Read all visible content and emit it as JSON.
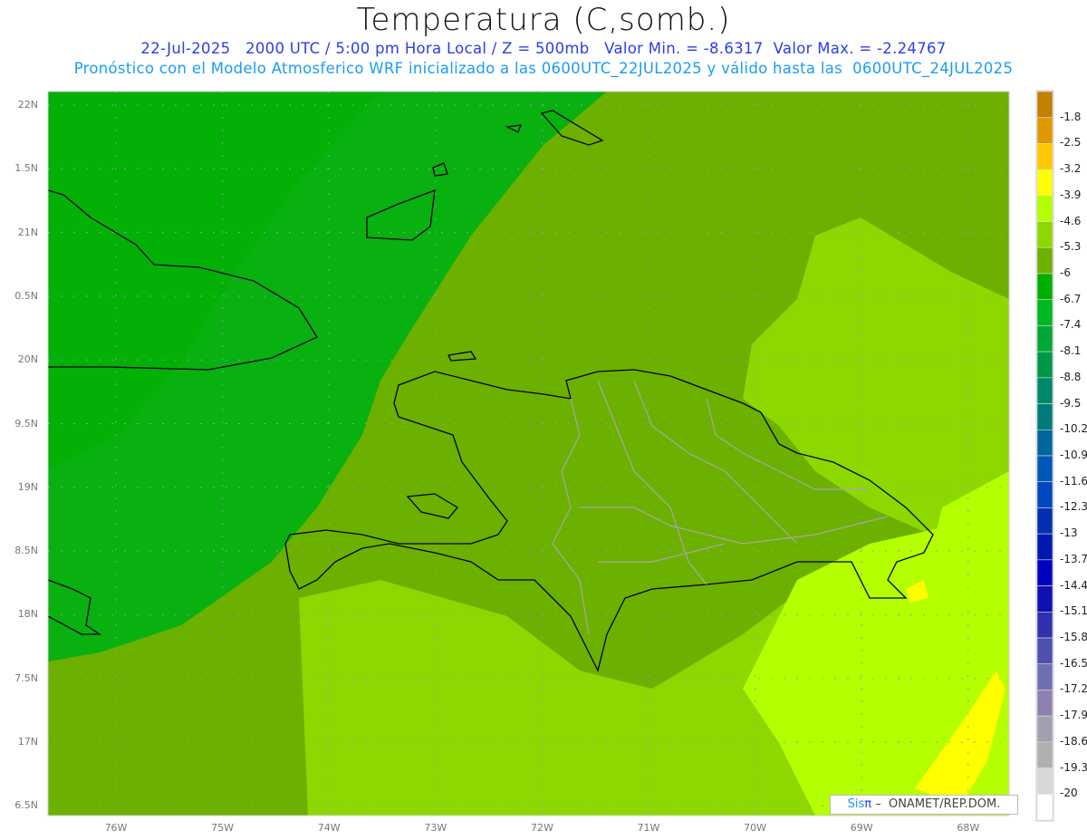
{
  "header": {
    "title": "Temperatura (C,somb.)",
    "subtitle": "22-Jul-2025   2000 UTC / 5:00 pm Hora Local / Z = 500mb   Valor Min. = -8.6317  Valor Max. = -2.24767",
    "description": "Pronóstico con el Modelo Atmosferico WRF inicializado a las 0600UTC_22JUL2025 y válido hasta las  0600UTC_24JUL2025"
  },
  "axes": {
    "lat_labels": [
      "22N",
      "1.5N",
      "21N",
      "0.5N",
      "20N",
      "9.5N",
      "19N",
      "8.5N",
      "18N",
      "7.5N",
      "17N",
      "6.5N"
    ],
    "lon_labels": [
      "76W",
      "75W",
      "74W",
      "73W",
      "72W",
      "71W",
      "70W",
      "69W",
      "68W"
    ]
  },
  "colorbar": {
    "labels": [
      "-1.8",
      "-2.5",
      "-3.2",
      "-3.9",
      "-4.6",
      "-5.3",
      "-6",
      "-6.7",
      "-7.4",
      "-8.1",
      "-8.8",
      "-9.5",
      "-10.2",
      "-10.9",
      "-11.6",
      "-12.3",
      "-13",
      "-13.7",
      "-14.4",
      "-15.1",
      "-15.8",
      "-16.5",
      "-17.2",
      "-17.9",
      "-18.6",
      "-19.3",
      "-20"
    ],
    "colors": [
      "#c08000",
      "#e09800",
      "#ffc800",
      "#ffff00",
      "#b4ff00",
      "#8cd800",
      "#6cb000",
      "#00b000",
      "#00b820",
      "#00a838",
      "#009848",
      "#008868",
      "#007c7c",
      "#00689c",
      "#0058b8",
      "#0048c0",
      "#0030b0",
      "#0018b0",
      "#0000c0",
      "#1010b0",
      "#3030b0",
      "#5050b0",
      "#7070b0",
      "#9080b0",
      "#a0a0b0",
      "#b0b0b0",
      "#d8d8d8",
      "#ffffff"
    ]
  },
  "footer": {
    "sis": "Sis",
    "pi": "π",
    "org": " –  ONAMET/REP.DOM."
  }
}
